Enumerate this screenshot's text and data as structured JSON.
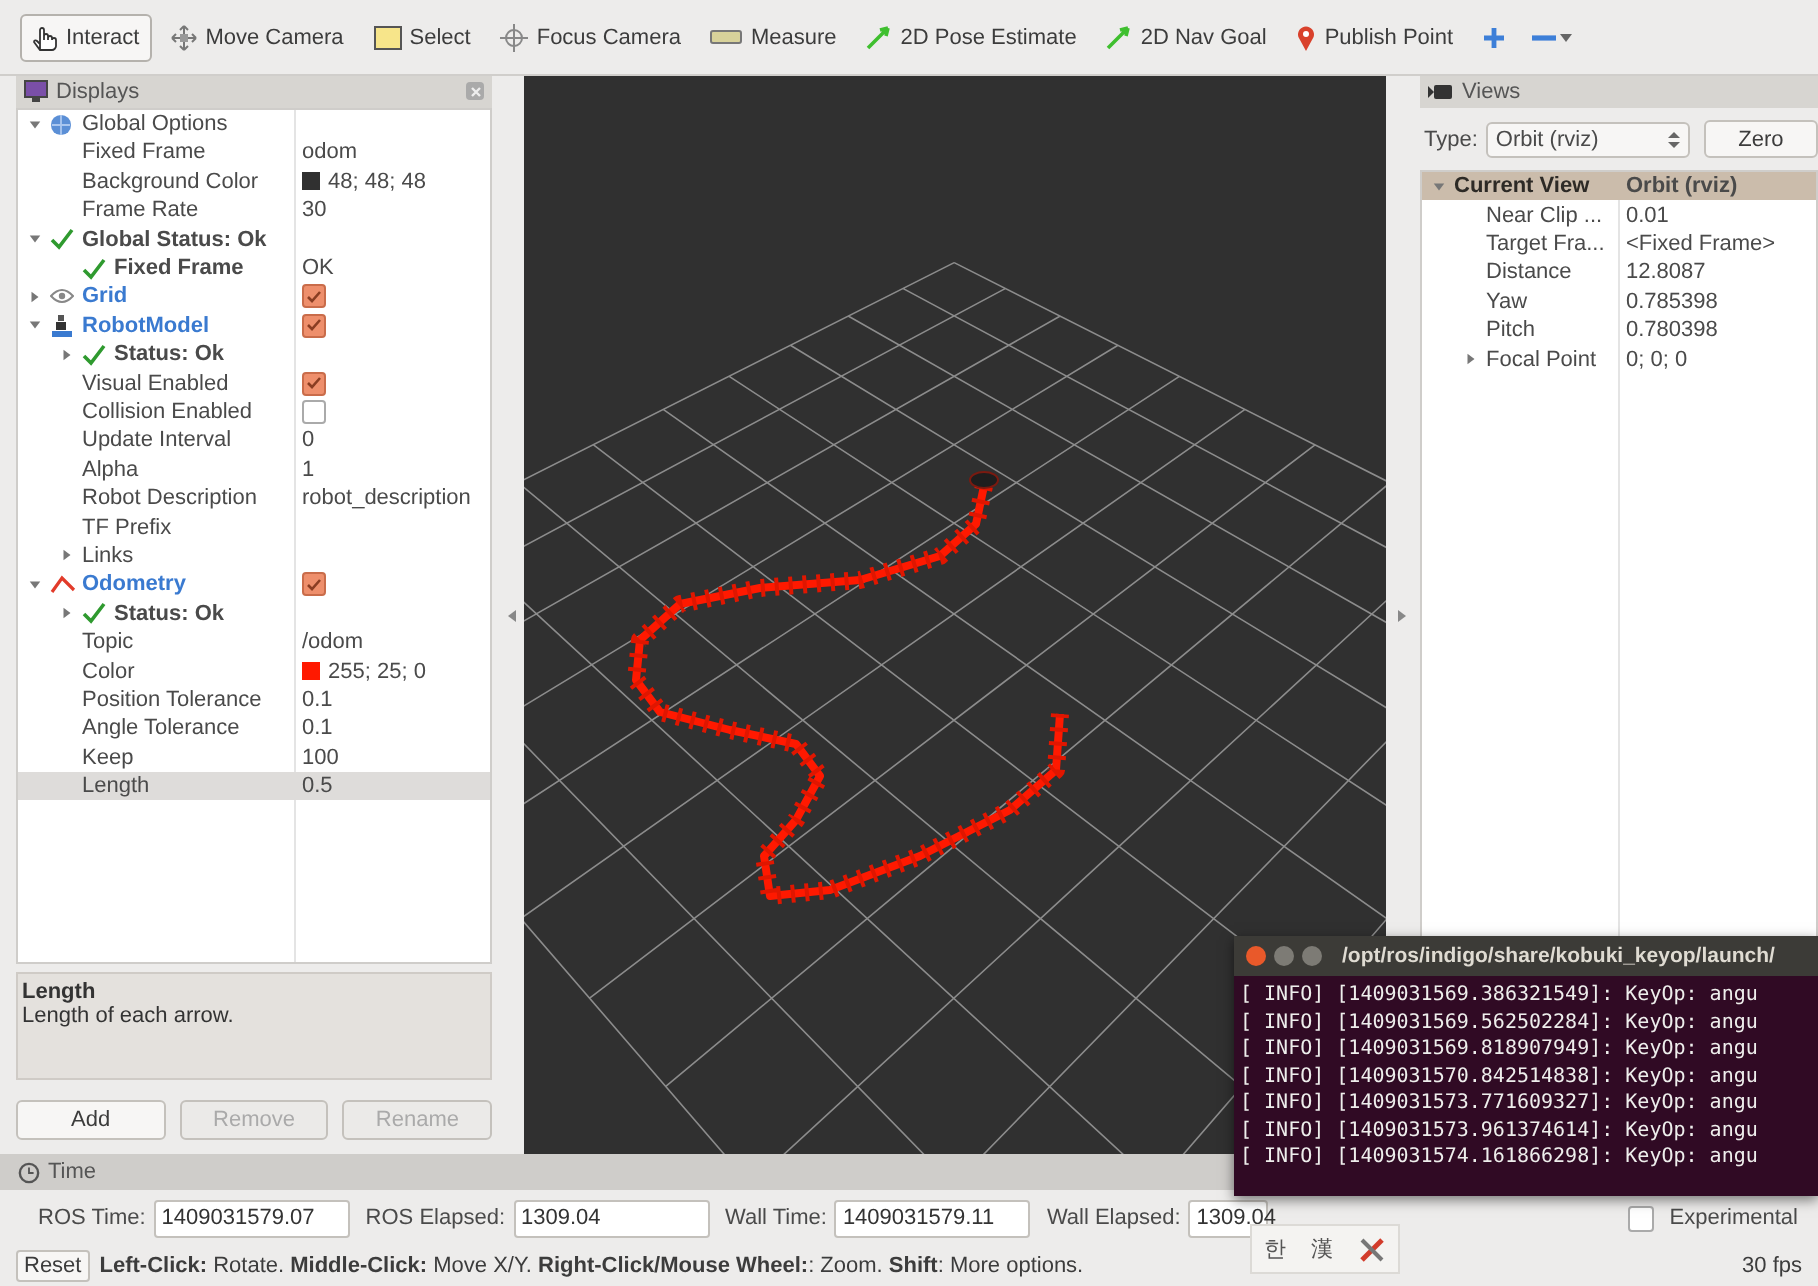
{
  "toolbar": {
    "tools": [
      {
        "kind": "interact",
        "label": "Interact",
        "selected": true
      },
      {
        "kind": "move",
        "label": "Move Camera",
        "selected": false
      },
      {
        "kind": "select",
        "label": "Select",
        "selected": false
      },
      {
        "kind": "focus",
        "label": "Focus Camera",
        "selected": false
      },
      {
        "kind": "measure",
        "label": "Measure",
        "selected": false
      },
      {
        "kind": "pose",
        "label": "2D Pose Estimate",
        "selected": false
      },
      {
        "kind": "goal",
        "label": "2D Nav Goal",
        "selected": false
      },
      {
        "kind": "point",
        "label": "Publish Point",
        "selected": false
      }
    ],
    "extra": [
      {
        "kind": "add"
      },
      {
        "kind": "remove"
      }
    ]
  },
  "displays": {
    "title": "Displays",
    "items": [
      {
        "kind": "group",
        "label": "Global Options",
        "expanded": true,
        "selected": false,
        "children": [
          {
            "kind": "property",
            "label": "Fixed Frame",
            "value": "odom",
            "selected": false
          },
          {
            "kind": "property",
            "label": "Background Color",
            "value": "48; 48; 48",
            "color": "#303030",
            "selected": false
          },
          {
            "kind": "property",
            "label": "Frame Rate",
            "value": "30",
            "selected": false
          }
        ]
      },
      {
        "kind": "status",
        "label": "Global Status: Ok",
        "expanded": true,
        "selected": false,
        "children": [
          {
            "kind": "status",
            "label": "Fixed Frame",
            "value": "OK",
            "selected": false
          }
        ]
      },
      {
        "kind": "grid",
        "label": "Grid",
        "checked": true,
        "expanded": false,
        "selected": false
      },
      {
        "kind": "robot",
        "label": "RobotModel",
        "checked": true,
        "expanded": true,
        "selected": false,
        "children": [
          {
            "kind": "status",
            "label": "Status: Ok",
            "expanded": false,
            "selected": false
          },
          {
            "kind": "property",
            "label": "Visual Enabled",
            "checked": true,
            "selected": false
          },
          {
            "kind": "property",
            "label": "Collision Enabled",
            "checked": false,
            "selected": false
          },
          {
            "kind": "property",
            "label": "Update Interval",
            "value": "0",
            "selected": false
          },
          {
            "kind": "property",
            "label": "Alpha",
            "value": "1",
            "selected": false
          },
          {
            "kind": "property",
            "label": "Robot Description",
            "value": "robot_description",
            "selected": false
          },
          {
            "kind": "property",
            "label": "TF Prefix",
            "selected": false
          },
          {
            "kind": "property",
            "label": "Links",
            "expanded": false,
            "selected": false
          }
        ]
      },
      {
        "kind": "odometry",
        "label": "Odometry",
        "checked": true,
        "expanded": true,
        "selected": false,
        "children": [
          {
            "kind": "status",
            "label": "Status: Ok",
            "expanded": false,
            "selected": false
          },
          {
            "kind": "property",
            "label": "Topic",
            "value": "/odom",
            "selected": false
          },
          {
            "kind": "property",
            "label": "Color",
            "value": "255; 25; 0",
            "color": "#ff1900",
            "selected": false
          },
          {
            "kind": "property",
            "label": "Position Tolerance",
            "value": "0.1",
            "selected": false
          },
          {
            "kind": "property",
            "label": "Angle Tolerance",
            "value": "0.1",
            "selected": false
          },
          {
            "kind": "property",
            "label": "Keep",
            "value": "100",
            "selected": false
          },
          {
            "kind": "property",
            "label": "Length",
            "value": "0.5",
            "selected": true
          }
        ]
      }
    ],
    "description": {
      "title": "Length",
      "text": "Length of each arrow."
    },
    "buttons": [
      {
        "label": "Add",
        "disabled": false
      },
      {
        "label": "Remove",
        "disabled": true
      },
      {
        "label": "Rename",
        "disabled": true
      }
    ]
  },
  "views": {
    "title": "Views",
    "type_label": "Type:",
    "type_value": "Orbit (rviz)",
    "zero_button": "Zero",
    "items": [
      {
        "kind": "category",
        "label": "Current View",
        "value": "Orbit (rviz)",
        "expanded": true,
        "selected": true,
        "children": [
          {
            "kind": "property",
            "label": "Near Clip ...",
            "value": "0.01",
            "selected": false
          },
          {
            "kind": "property",
            "label": "Target Fra...",
            "value": "<Fixed Frame>",
            "selected": false
          },
          {
            "kind": "property",
            "label": "Distance",
            "value": "12.8087",
            "selected": false
          },
          {
            "kind": "property",
            "label": "Yaw",
            "value": "0.785398",
            "selected": false
          },
          {
            "kind": "property",
            "label": "Pitch",
            "value": "0.780398",
            "selected": false
          },
          {
            "kind": "property",
            "label": "Focal Point",
            "value": "0; 0; 0",
            "expanded": false,
            "selected": false
          }
        ]
      }
    ]
  },
  "time": {
    "title": "Time",
    "fields": [
      {
        "label": "ROS Time:",
        "value": "1409031579.07"
      },
      {
        "label": "ROS Elapsed:",
        "value": "1309.04"
      },
      {
        "label": "Wall Time:",
        "value": "1409031579.11"
      },
      {
        "label": "Wall Elapsed:",
        "value": "1309.04"
      }
    ],
    "experimental": {
      "label": "Experimental",
      "checked": false
    }
  },
  "status_bar": {
    "reset": "Reset",
    "help": "**Left-Click:** Rotate. **Middle-Click:** Move X/Y. **Right-Click/Mouse Wheel:**: Zoom. **Shift**: More options.",
    "fps": "30 fps"
  },
  "terminal": {
    "title": "/opt/ros/indigo/share/kobuki_keyop/launch/",
    "lines": [
      "[ INFO] [1409031569.386321549]: KeyOp: angu",
      "[ INFO] [1409031569.562502284]: KeyOp: angu",
      "[ INFO] [1409031569.818907949]: KeyOp: angu",
      "[ INFO] [1409031570.842514838]: KeyOp: angu",
      "[ INFO] [1409031573.771609327]: KeyOp: angu",
      "[ INFO] [1409031573.961374614]: KeyOp: angu",
      "[ INFO] [1409031574.161866298]: KeyOp: angu"
    ]
  },
  "ime": {
    "items": [
      "한",
      "漢"
    ]
  }
}
